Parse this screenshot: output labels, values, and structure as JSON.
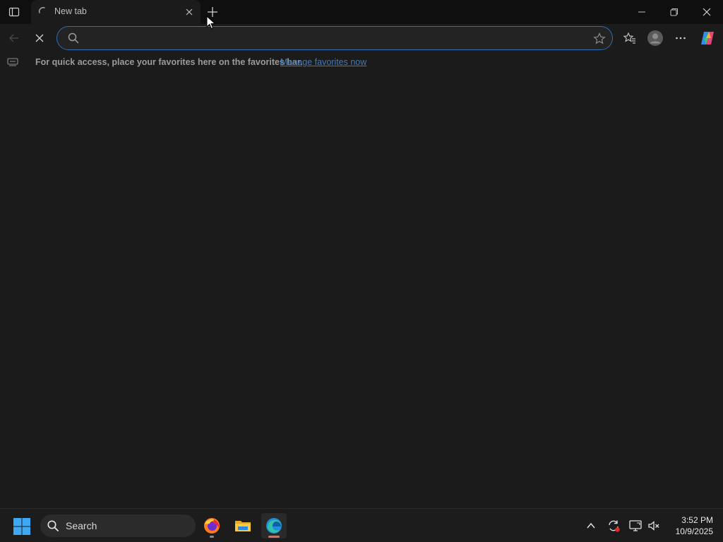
{
  "browser": {
    "tab": {
      "title": "New tab"
    },
    "address": {
      "value": "",
      "placeholder": ""
    },
    "favorites_bar": {
      "message": "For quick access, place your favorites here on the favorites bar.",
      "link": "Manage favorites now"
    }
  },
  "taskbar": {
    "search_label": "Search",
    "clock": {
      "time": "3:52 PM",
      "date": "10/9/2025"
    }
  },
  "colors": {
    "accent": "#2f6fb3",
    "link": "#3f79b8",
    "edge_indicator": "#e06c5a"
  },
  "icons": [
    "tab-actions-icon",
    "loading-spinner-icon",
    "close-icon",
    "plus-icon",
    "minimize-icon",
    "restore-icon",
    "back-arrow-icon",
    "stop-icon",
    "search-icon",
    "star-icon",
    "favorites-icon",
    "profile-icon",
    "more-icon",
    "copilot-icon",
    "favorites-bar-icon",
    "windows-logo-icon",
    "firefox-icon",
    "file-explorer-icon",
    "edge-icon",
    "chevron-up-icon",
    "sync-icon",
    "display-icon",
    "speaker-muted-icon"
  ]
}
